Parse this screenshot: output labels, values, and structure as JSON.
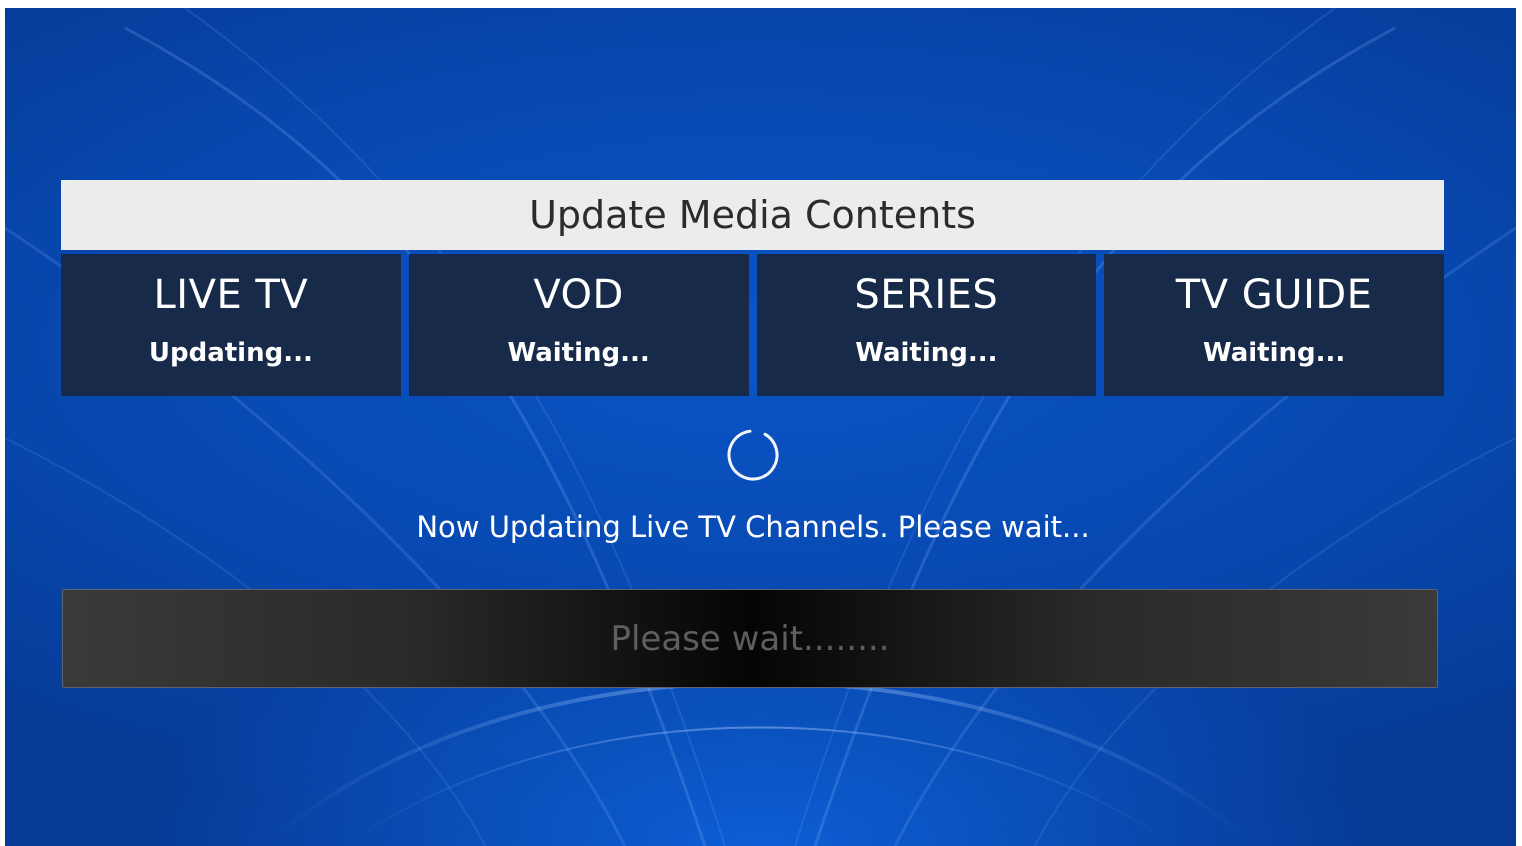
{
  "header": {
    "title": "Update Media Contents"
  },
  "tiles": [
    {
      "title": "LIVE TV",
      "status": "Updating..."
    },
    {
      "title": "VOD",
      "status": "Waiting..."
    },
    {
      "title": "SERIES",
      "status": "Waiting..."
    },
    {
      "title": "TV GUIDE",
      "status": "Waiting..."
    }
  ],
  "status_message": "Now Updating Live TV Channels. Please wait...",
  "progress": {
    "text": "Please wait........",
    "value_percent": 0
  },
  "icons": {
    "spinner": "loading-spinner-icon"
  },
  "colors": {
    "background": "#0747ad",
    "header_bg": "#ececec",
    "tile_bg": "#172a4a",
    "text": "#ffffff"
  }
}
